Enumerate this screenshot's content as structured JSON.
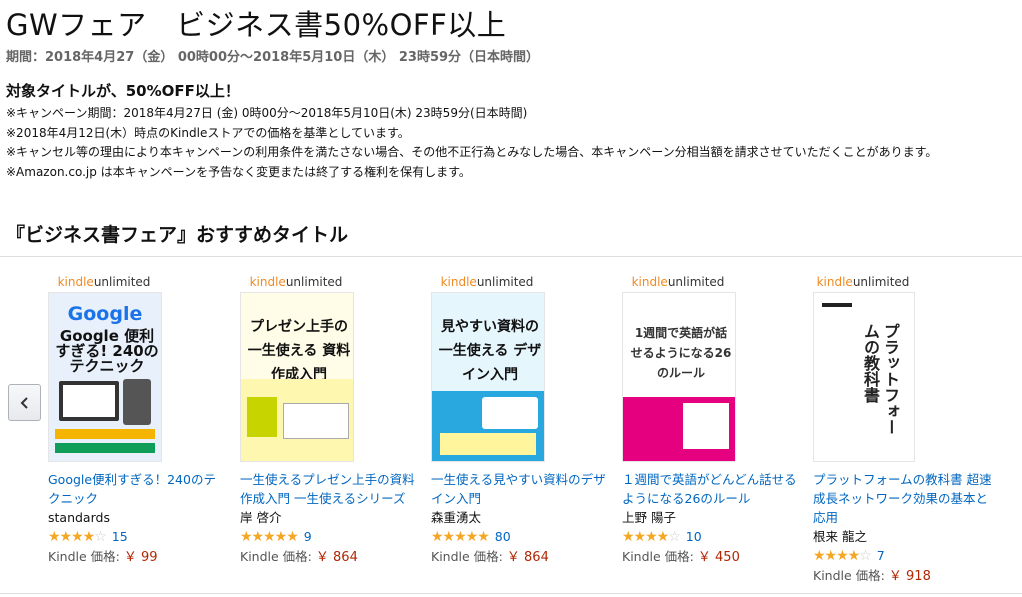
{
  "header": {
    "title": "GWフェア　ビジネス書50%OFF以上",
    "period": "期間：2018年4月27（金） 00時00分〜2018年5月10日（木） 23時59分（日本時間）"
  },
  "campaign": {
    "subhead": "対象タイトルが、50%OFF以上！",
    "notes": [
      "※キャンペーン期間：2018年4月27日 (金) 0時00分〜2018年5月10日(木) 23時59分(日本時間)",
      "※2018年4月12日(木）時点のKindleストアでの価格を基準としています。",
      "※キャンセル等の理由により本キャンペーンの利用条件を満たさない場合、その他不正行為とみなした場合、本キャンペーン分相当額を請求させていただくことがあります。",
      "※Amazon.co.jp は本キャンペーンを予告なく変更または終了する権利を保有します。"
    ]
  },
  "carousel": {
    "section_title": "『ビジネス書フェア』おすすめタイトル",
    "kindle_badge_k": "kindle",
    "kindle_badge_u": "unlimited",
    "price_label": "Kindle 価格:",
    "items": [
      {
        "title": "Google便利すぎる！240のテクニック",
        "author": "standards",
        "rating": 3.5,
        "stars": "★★★★☆",
        "review_count": "15",
        "price": "￥ 99",
        "cover_text": "Google 便利すぎる! 240のテクニック",
        "cover_color": "#e8f0fb",
        "accent": "#1a73e8"
      },
      {
        "title": "一生使えるプレゼン上手の資料作成入門 一生使えるシリーズ",
        "author": "岸 啓介",
        "rating": 4.5,
        "stars": "★★★★★",
        "review_count": "9",
        "price": "￥ 864",
        "cover_text": "プレゼン上手の 一生使える 資料作成入門",
        "cover_color": "#fffde7",
        "accent": "#c8d400"
      },
      {
        "title": "一生使える見やすい資料のデザイン入門",
        "author": "森重湧太",
        "rating": 4.5,
        "stars": "★★★★★",
        "review_count": "80",
        "price": "￥ 864",
        "cover_text": "見やすい資料の 一生使える デザイン入門",
        "cover_color": "#e6f6fd",
        "accent": "#29a8e0"
      },
      {
        "title": "１週間で英語がどんどん話せるようになる26のルール",
        "author": "上野 陽子",
        "rating": 3.5,
        "stars": "★★★★☆",
        "review_count": "10",
        "price": "￥ 450",
        "cover_text": "1週間で英語が話せるようになる26のルール",
        "cover_color": "#ffffff",
        "accent": "#e4007f"
      },
      {
        "title": "プラットフォームの教科書 超速成長ネットワーク効果の基本と応用",
        "author": "根来 龍之",
        "rating": 4,
        "stars": "★★★★☆",
        "review_count": "7",
        "price": "￥ 918",
        "cover_text": "プラットフォームの教科書",
        "cover_color": "#ffffff",
        "accent": "#222222"
      }
    ]
  }
}
